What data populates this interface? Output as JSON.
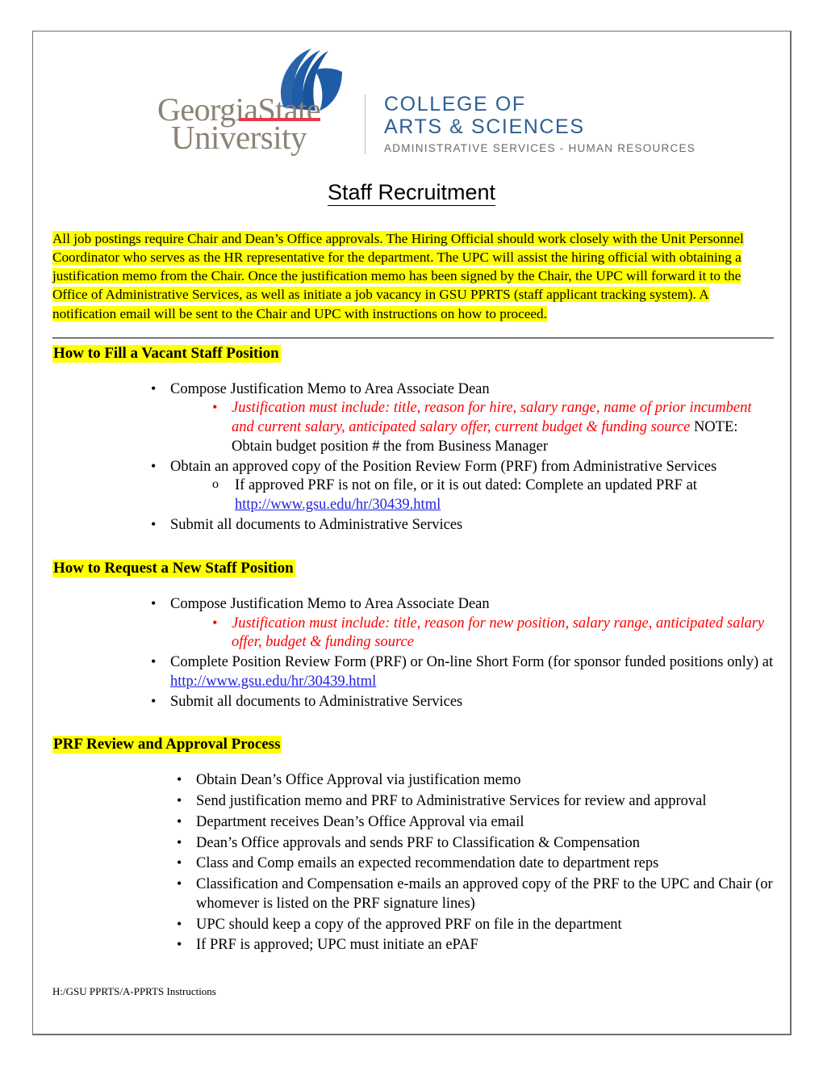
{
  "logo": {
    "flame_icon": "gsu-flame-icon",
    "wordmark_line1": "GeorgiaState",
    "wordmark_line2": "University",
    "college_line1": "COLLEGE OF",
    "college_line2": "ARTS & SCIENCES",
    "college_sub": "ADMINISTRATIVE SERVICES - HUMAN RESOURCES",
    "colors": {
      "flame_blue": "#1f5ca8",
      "wordmark_taupe": "#8b8375",
      "accent_red": "#e8384a",
      "college_blue": "#2d5f93",
      "sub_gray": "#6a6a6a"
    }
  },
  "title": "Staff Recruitment",
  "intro": "All job postings require Chair and Dean’s Office approvals.  The Hiring Official should work closely with the Unit Personnel Coordinator who serves as the HR representative for the department.  The UPC will assist the hiring official with obtaining a justification memo from the Chair.  Once the justification memo has been signed by the Chair, the UPC will forward it to the Office of Administrative Services, as well as initiate a job vacancy in GSU PPRTS (staff applicant tracking system). A notification email will be sent to the Chair and UPC with instructions on how to proceed.",
  "sections": [
    {
      "heading": "How to Fill a Vacant Staff Position",
      "items": [
        "Compose Justification Memo to Area Associate Dean",
        "Obtain an approved copy of the Position Review Form (PRF) from Administrative Services",
        "Submit all documents to Administrative Services"
      ],
      "sub_red": "Justification must include: title, reason for hire, salary range, name of prior incumbent and current salary, anticipated salary offer, current budget & funding source",
      "sub_red_tail": " NOTE: Obtain budget position # the from Business Manager",
      "sub_circle": "If approved PRF is not on file, or it is out dated: Complete an updated PRF at",
      "link": "http://www.gsu.edu/hr/30439.html"
    },
    {
      "heading": "How to Request a New Staff Position",
      "items": [
        "Compose Justification Memo to Area Associate Dean",
        "Submit all documents to Administrative Services"
      ],
      "sub_red": "Justification must include: title, reason for new position, salary range, anticipated salary offer, budget & funding source",
      "complete_prefix": "Complete Position Review Form (PRF) or On-line Short Form (for sponsor funded positions only) at ",
      "link": "http://www.gsu.edu/hr/30439.html"
    },
    {
      "heading": "PRF Review and Approval Process",
      "items": [
        "Obtain Dean’s Office Approval via justification memo",
        "Send justification memo and PRF to Administrative Services for review and approval",
        "Department receives Dean’s Office Approval via email",
        "Dean’s Office approvals and sends PRF to Classification & Compensation",
        "Class and Comp emails an expected recommendation date to department reps",
        "Classification and Compensation e-mails an approved copy of the PRF to the UPC and Chair (or whomever is listed on the PRF signature lines)",
        "UPC should keep a copy of the approved PRF on file in the department",
        "If PRF is approved; UPC must initiate an ePAF"
      ]
    }
  ],
  "footer": "H:/GSU PPRTS/A-PPRTS Instructions",
  "highlight_color": "#ffff00",
  "link_color": "#2222dd",
  "red_color": "#ff0000"
}
